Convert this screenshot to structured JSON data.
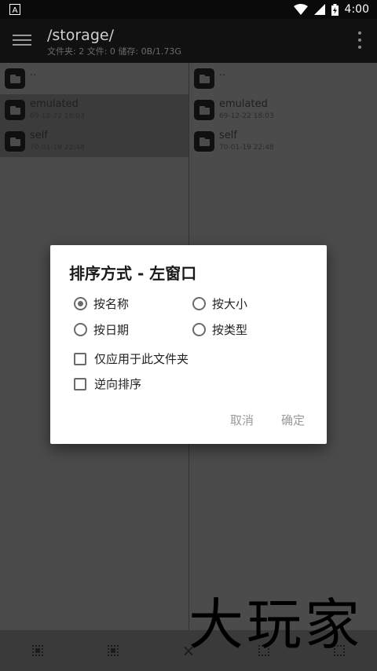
{
  "status_bar": {
    "time": "4:00",
    "notification_icon": "a-icon"
  },
  "app_bar": {
    "title": "/storage/",
    "info": "文件夹: 2  文件: 0  储存: 0B/1.73G"
  },
  "left_pane": {
    "items": [
      {
        "name": "..",
        "date": ""
      },
      {
        "name": "emulated",
        "date": "69-12-22 18:03"
      },
      {
        "name": "self",
        "date": "70-01-19 22:48"
      }
    ]
  },
  "right_pane": {
    "items": [
      {
        "name": "..",
        "date": ""
      },
      {
        "name": "emulated",
        "date": "69-12-22 18:03"
      },
      {
        "name": "self",
        "date": "70-01-19 22:48"
      }
    ]
  },
  "dialog": {
    "title": "排序方式 - 左窗口",
    "options": [
      {
        "label": "按名称",
        "selected": true
      },
      {
        "label": "按大小",
        "selected": false
      },
      {
        "label": "按日期",
        "selected": false
      },
      {
        "label": "按类型",
        "selected": false
      }
    ],
    "checkboxes": [
      {
        "label": "仅应用于此文件夹",
        "checked": false
      },
      {
        "label": "逆向排序",
        "checked": false
      }
    ],
    "cancel_label": "取消",
    "ok_label": "确定"
  },
  "watermark": "大玩家"
}
